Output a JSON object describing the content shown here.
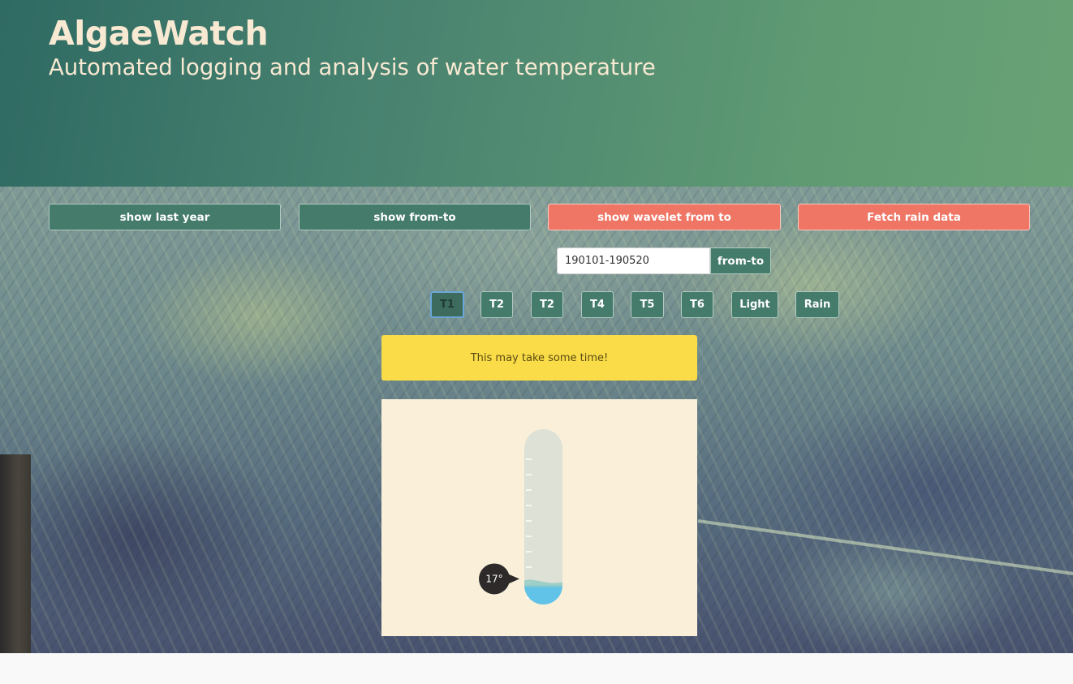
{
  "header": {
    "title": "AlgaeWatch",
    "subtitle": "Automated logging and analysis of water temperature"
  },
  "actions": {
    "show_last_year": "show last year",
    "show_from_to": "show from-to",
    "show_wavelet": "show wavelet from to",
    "fetch_rain": "Fetch rain data"
  },
  "range": {
    "value": "190101-190520",
    "button_label": "from-to"
  },
  "sensors": [
    {
      "label": "T1",
      "active": true
    },
    {
      "label": "T2",
      "active": false
    },
    {
      "label": "T2",
      "active": false
    },
    {
      "label": "T4",
      "active": false
    },
    {
      "label": "T5",
      "active": false
    },
    {
      "label": "T6",
      "active": false
    },
    {
      "label": "Light",
      "active": false
    },
    {
      "label": "Rain",
      "active": false
    }
  ],
  "notice": {
    "text": "This may take some time!"
  },
  "thermometer": {
    "reading_label": "17°",
    "level_fraction": 0.12
  },
  "colors": {
    "header_start": "#2f6a63",
    "header_end": "#69a274",
    "button_green": "#447b6a",
    "button_coral": "#ef7565",
    "notice_yellow": "#f9dc48",
    "panel_cream": "#faf0da",
    "mercury_blue": "#62c3e8"
  }
}
